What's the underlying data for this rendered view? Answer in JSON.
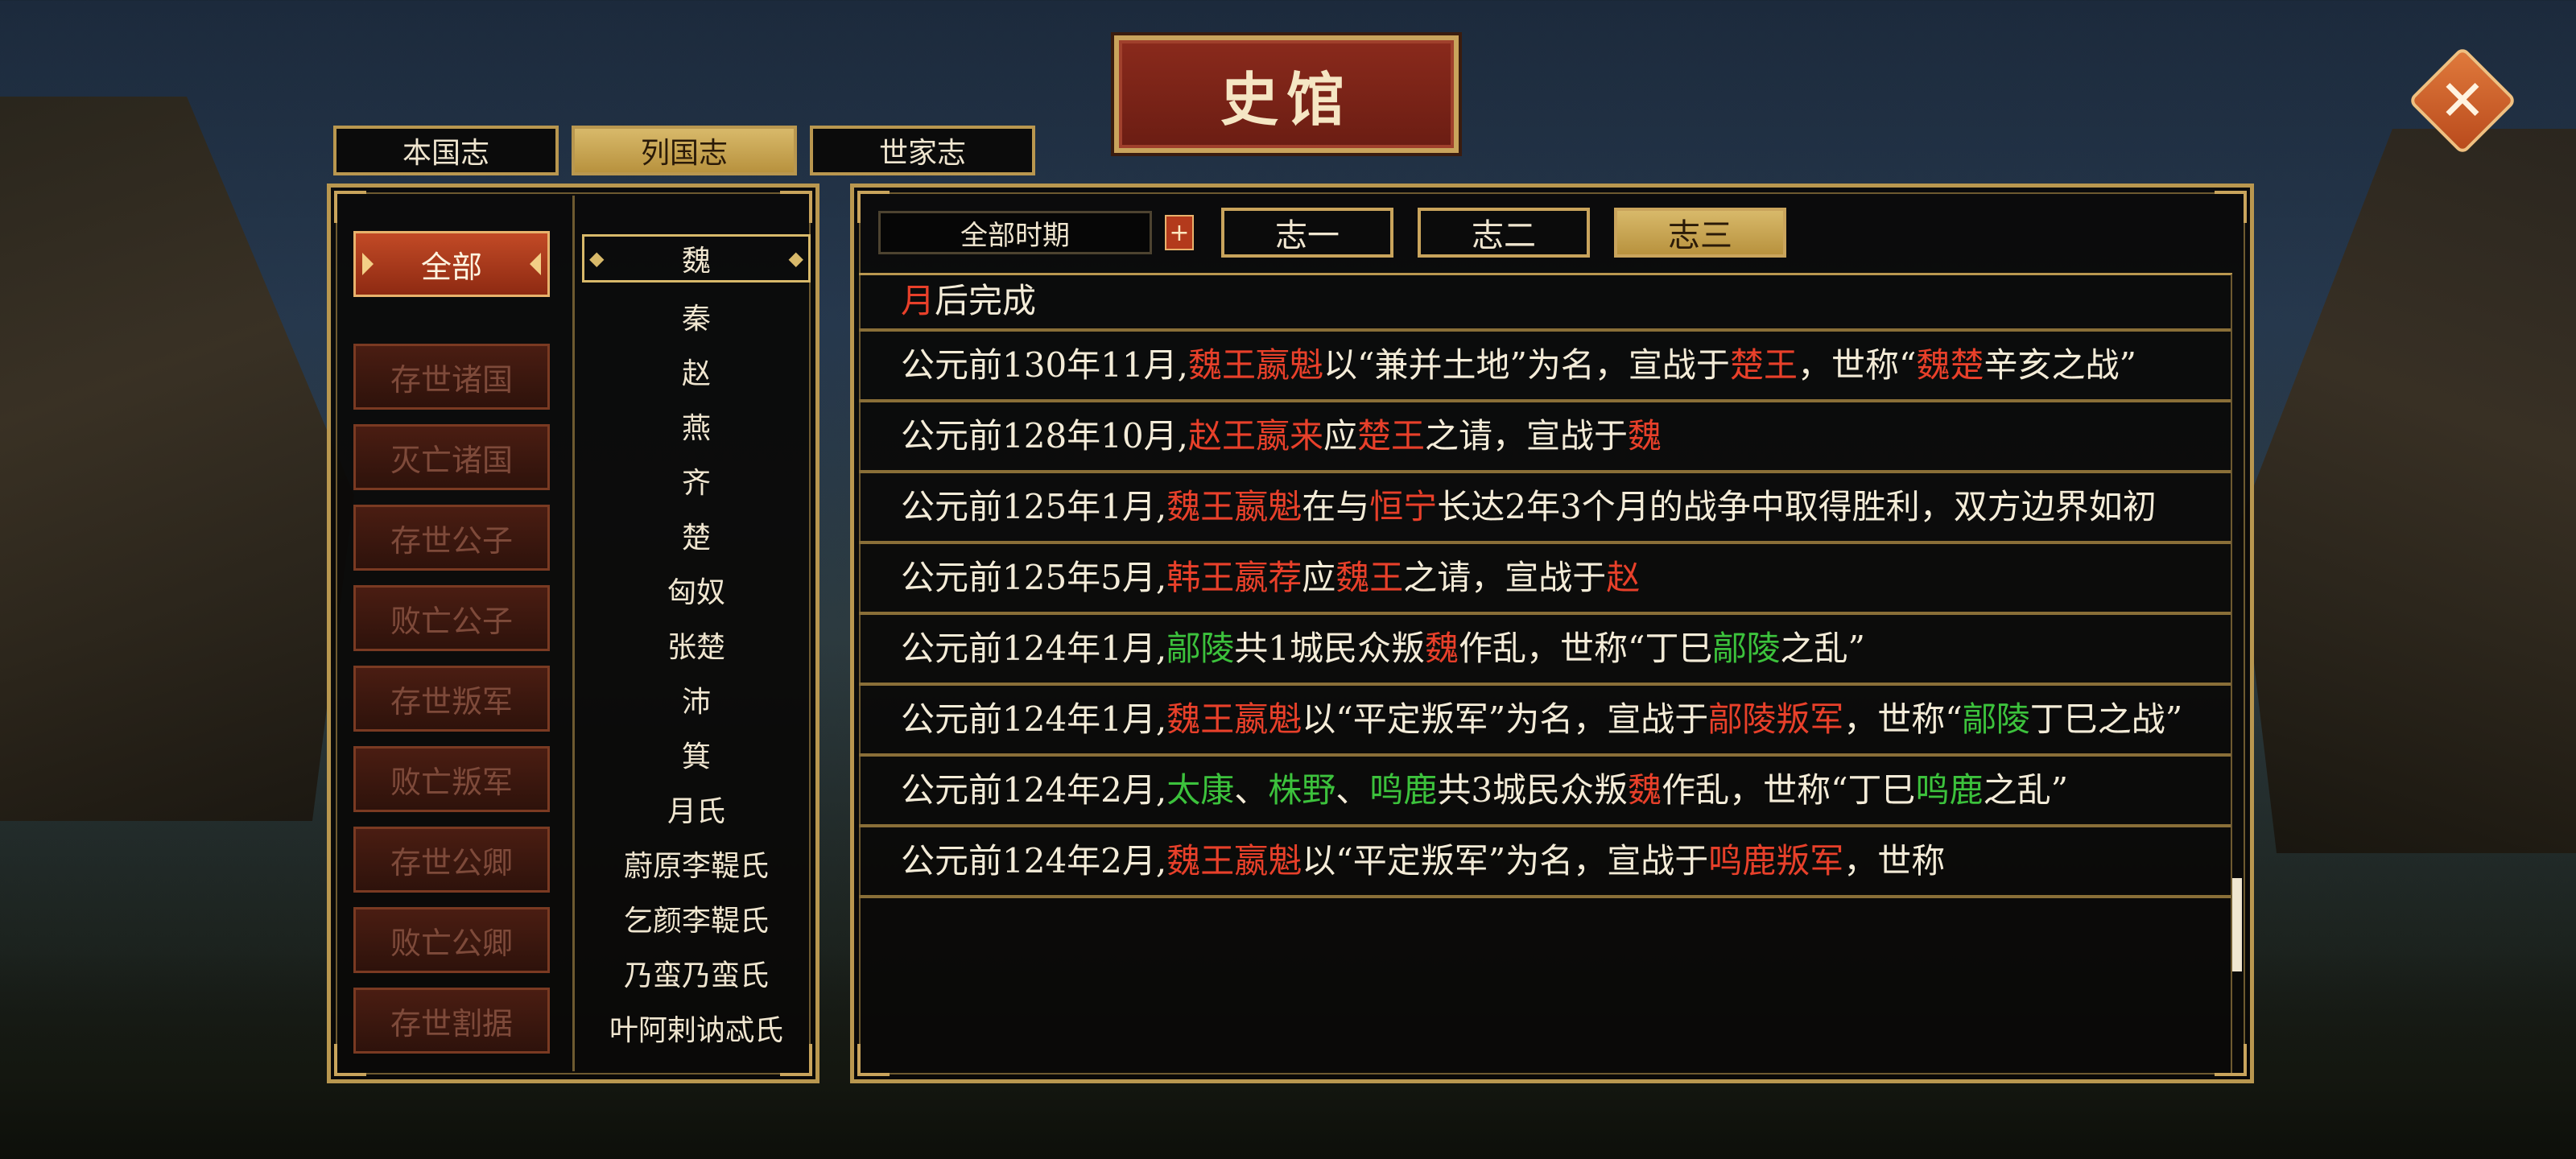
{
  "title": "史馆",
  "top_tabs": [
    "本国志",
    "列国志",
    "世家志"
  ],
  "categories": [
    "全部",
    "存世诸国",
    "灭亡诸国",
    "存世公子",
    "败亡公子",
    "存世叛军",
    "败亡叛军",
    "存世公卿",
    "败亡公卿",
    "存世割据"
  ],
  "states": [
    "魏",
    "秦",
    "赵",
    "燕",
    "齐",
    "楚",
    "匈奴",
    "张楚",
    "沛",
    "箕",
    "月氏",
    "蔚原李鞮氏",
    "乞颜李鞮氏",
    "乃蛮乃蛮氏",
    "叶阿剌讷忒氏"
  ],
  "filter": {
    "period": "全部时期",
    "plus": "+",
    "volumes": [
      "志一",
      "志二",
      "志三"
    ]
  },
  "close": "✕",
  "entries": {
    "e0": {
      "a": "月",
      "b": "后完成"
    },
    "e1": {
      "date": "公元前130年11月,",
      "actor": "魏王嬴魁",
      "t1": "以“兼并土地”为名，宣战于",
      "target": "楚王",
      "t2": "，世称“",
      "w1": "魏楚",
      "t3": "辛亥之战”"
    },
    "e2": {
      "date": "公元前128年10月,",
      "actor": "赵王嬴来",
      "t1": "应",
      "target": "楚王",
      "t2": "之请，宣战于",
      "w1": "魏"
    },
    "e3": {
      "date": "公元前125年1月,",
      "actor": "魏王嬴魁",
      "t1": "在与",
      "target": "恒宁",
      "t2": "长达2年3个月的战争中取得胜利，双方边界如初"
    },
    "e4": {
      "date": "公元前125年5月,",
      "actor": "韩王嬴荐",
      "t1": "应",
      "target": "魏王",
      "t2": "之请，宣战于",
      "w1": "赵"
    },
    "e5": {
      "date": "公元前124年1月,",
      "place": "鄗陵",
      "t1": "共1城民众叛",
      "state": "魏",
      "t2": "作乱，世称“丁巳",
      "place2": "鄗陵",
      "t3": "之乱”"
    },
    "e6": {
      "date": "公元前124年1月,",
      "actor": "魏王嬴魁",
      "t1": "以“平定叛军”为名，宣战于",
      "target": "鄗陵叛军",
      "t2": "，世称“",
      "place": "鄗陵",
      "t3": "丁巳之战”"
    },
    "e7": {
      "date": "公元前124年2月,",
      "p1": "太康",
      "sep1": "、",
      "p2": "株野",
      "sep2": "、",
      "p3": "鸣鹿",
      "t1": "共3城民众叛",
      "state": "魏",
      "t2": "作乱，世称“丁巳",
      "p4": "鸣鹿",
      "t3": "之乱”"
    },
    "e8": {
      "date": "公元前124年2月,",
      "actor": "魏王嬴魁",
      "t1": "以“平定叛军”为名，宣战于",
      "target": "鸣鹿叛军",
      "t2": "，世称"
    }
  },
  "colors": {
    "gold": "#b9974f",
    "red_text": "#e8402a",
    "green_text": "#3cc23c",
    "active_tab": "#d8b96a"
  }
}
